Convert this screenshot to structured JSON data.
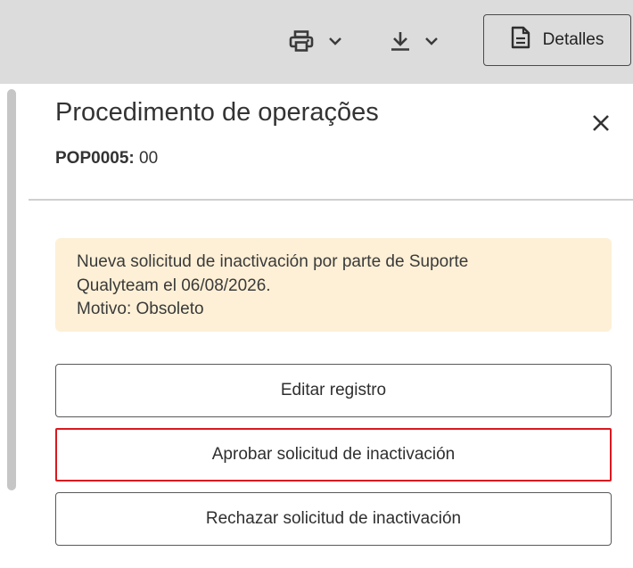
{
  "toolbar": {
    "print_icon": "printer-icon",
    "download_icon": "download-icon",
    "details_label": "Detalles",
    "details_icon": "document-icon"
  },
  "panel": {
    "title": "Procedimento de operações",
    "code_label": "POP0005:",
    "code_value": "00",
    "close_icon": "close-icon"
  },
  "notice": {
    "line1": "Nueva solicitud de inactivación por parte de Suporte",
    "line2": "Qualyteam el 06/08/2026.",
    "line3": "Motivo: Obsoleto",
    "background": "#fdf0d6"
  },
  "actions": {
    "edit_label": "Editar registro",
    "approve_label": "Aprobar solicitud de inactivación",
    "reject_label": "Rechazar solicitud de inactivación",
    "highlight_color": "#d9191f"
  }
}
